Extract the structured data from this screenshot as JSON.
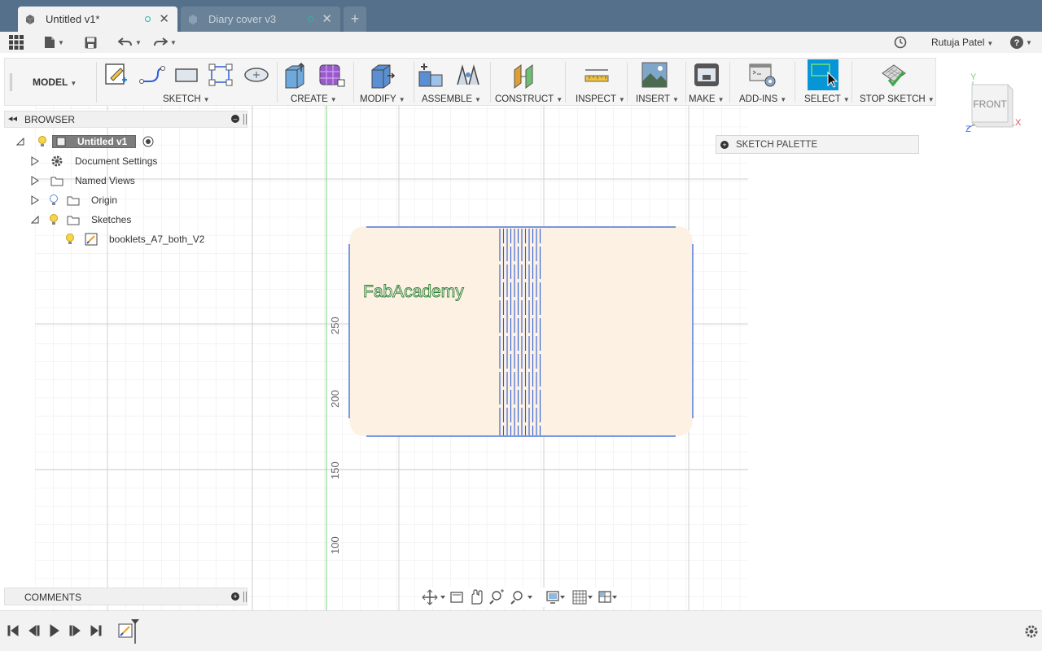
{
  "tabs": [
    {
      "label": "Untitled v1*",
      "active": true
    },
    {
      "label": "Diary cover v3",
      "active": false
    }
  ],
  "user": {
    "name": "Rutuja Patel"
  },
  "ribbon": {
    "workspace": "MODEL",
    "groups": [
      "SKETCH",
      "CREATE",
      "MODIFY",
      "ASSEMBLE",
      "CONSTRUCT",
      "INSPECT",
      "INSERT",
      "MAKE",
      "ADD-INS",
      "SELECT",
      "STOP SKETCH"
    ]
  },
  "browser": {
    "title": "BROWSER",
    "items": [
      {
        "label": "Untitled v1"
      },
      {
        "label": "Document Settings"
      },
      {
        "label": "Named Views"
      },
      {
        "label": "Origin"
      },
      {
        "label": "Sketches"
      },
      {
        "label": "booklets_A7_both_V2"
      }
    ]
  },
  "sketch_palette": {
    "label": "SKETCH PALETTE"
  },
  "comments": {
    "title": "COMMENTS"
  },
  "canvas": {
    "sketch_text": "FabAcademy",
    "ruler_labels": [
      "250",
      "200",
      "150",
      "100"
    ]
  },
  "viewcube": {
    "face": "FRONT",
    "axis_x": "X",
    "axis_y": "Y",
    "axis_z": "Z"
  },
  "colors": {
    "title_bar": "#55708a",
    "sketch_line": "#2b5fd9",
    "sketch_fill": "#fdf1e3",
    "sketch_text": "#2e7d32",
    "select_active": "#0696d7",
    "axis_green": "#8fd58f"
  }
}
